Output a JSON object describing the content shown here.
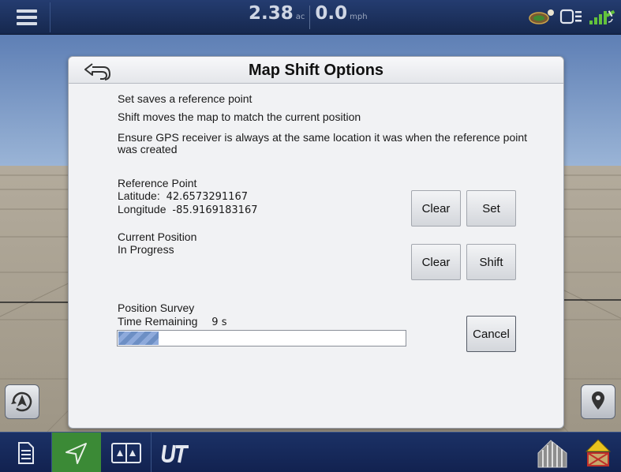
{
  "topbar": {
    "area_value": "2.38",
    "area_unit": "ac",
    "speed_value": "0.0",
    "speed_unit": "mph"
  },
  "dialog": {
    "title": "Map Shift Options",
    "info": [
      "Set saves a reference point",
      "Shift moves the map to match the current position",
      "Ensure GPS receiver is always at the same location it was when the reference point was created"
    ],
    "reference": {
      "heading": "Reference Point",
      "latitude_label": "Latitude:",
      "latitude_value": "42.6573291167",
      "longitude_label": "Longitude",
      "longitude_value": "-85.9169183167",
      "clear_label": "Clear",
      "set_label": "Set"
    },
    "current": {
      "heading": "Current Position",
      "status": "In Progress",
      "clear_label": "Clear",
      "shift_label": "Shift"
    },
    "survey": {
      "heading": "Position Survey",
      "time_label": "Time Remaining",
      "time_value": "9 s",
      "progress_fraction": 0.14,
      "cancel_label": "Cancel"
    }
  },
  "icons": {
    "menu": "hamburger-menu-icon",
    "back": "back-arrow-icon",
    "status": [
      "gps-antenna-icon",
      "device-icon",
      "satellite-signal-icon"
    ],
    "left_nav": "compass-navigation-icon",
    "right_map": "map-pin-icon",
    "bottom": [
      "documents-icon",
      "guidance-icon",
      "split-screen-icon",
      "universal-terminal-icon",
      "planter-icon",
      "warning-icon"
    ]
  },
  "colors": {
    "topbar": "#1c3064",
    "active_tab": "#3b8a36",
    "progress_fill": "#7a9bd0"
  }
}
